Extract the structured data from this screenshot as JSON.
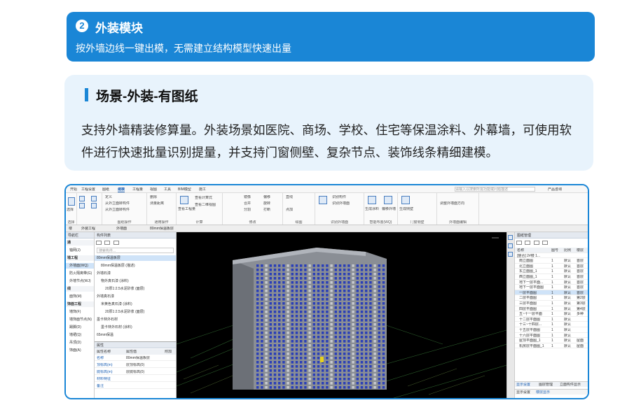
{
  "header": {
    "number": "2",
    "title": "外装模块",
    "subtitle": "按外墙边线一键出模，无需建立结构模型快速出量"
  },
  "card": {
    "title": "场景-外装-有图纸",
    "description": "支持外墙精装修算量。外装场景如医院、商场、学校、住宅等保温涂料、外幕墙，可使用软件进行快速批量识别提量，并支持门窗侧壁、复杂节点、装饰线条精细建模。"
  },
  "app": {
    "menu": [
      "开始",
      "工程设置",
      "图纸",
      "建模",
      "工程量",
      "视图",
      "工具",
      "BIM模型",
      "施工"
    ],
    "active_menu": "建模",
    "search_placeholder": "请输入以搜索所需功能或问题描述",
    "account": "产品咨询",
    "ribbon_groups": [
      {
        "label": "选择",
        "items": [
          "选择"
        ]
      },
      {
        "label": "图纸操作",
        "items": [
          "定义",
          "从外立面转构件",
          "从外立面转构件"
        ]
      },
      {
        "label": "通用操作",
        "items": [
          "删除",
          "测量距离"
        ]
      },
      {
        "label": "计算",
        "items": [
          "查看工程量",
          "查看计算式",
          "查看二维视图"
        ]
      },
      {
        "label": "修改",
        "items": [
          "镜像",
          "偏移",
          "合并",
          "分割",
          "旋转",
          "打断"
        ]
      },
      {
        "label": "绘图",
        "items": [
          "直线",
          "点加"
        ]
      },
      {
        "label": "识别外墙面",
        "items": [
          "识别构件",
          "识别外墙面"
        ]
      },
      {
        "label": "智能布置(WQ)",
        "items": [
          "生成涂料",
          "偏移外墙"
        ]
      },
      {
        "label": "门窗侧壁",
        "items": [
          "生成侧壁"
        ]
      },
      {
        "label": "外墙面编辑",
        "items": [
          "调整外墙面方向"
        ]
      }
    ],
    "sub_bar": [
      "楼",
      "外装工程",
      "外墙面",
      "80mm保温板层"
    ],
    "nav": {
      "title": "导航栏",
      "items": [
        "通",
        "轴网(J)",
        "墙工程",
        "外墙面(WQ)",
        "防火隔离带(G)",
        "外墙节点(WJ)",
        "线",
        "面饰(M)",
        "饰面工程",
        "墙饰(F)",
        "墙饰面节点(N)",
        "踢脚(D)",
        "墙裙(Q)",
        "吊顶(D)",
        "饰面(A)"
      ]
    },
    "tree": {
      "title": "构件列表",
      "search_placeholder": "搜索构件...",
      "items": [
        "80mm保温板层",
        "80mm保温板层 (描述)",
        "外墙石漆",
        "物外真石漆 (涂料)",
        "20厚1:2.5水泥砂浆 (面层)",
        "外墙真石漆",
        "米黄色真石漆 (涂料)",
        "20厚1:2.5水泥砂浆 (面层)",
        "墨卡林外石材",
        "墨卡林外石材 (涂料)",
        "65mm保温"
      ]
    },
    "props": {
      "title": "属性",
      "columns": [
        "属性名称",
        "属性值",
        "附加"
      ],
      "rows": [
        [
          "名称",
          "80mm保温板层"
        ],
        [
          "顶标高(m)",
          "层顶标高(0)"
        ],
        [
          "底标高(m)",
          "层底标高(0)"
        ],
        [
          "材料特征",
          ""
        ],
        [
          "备注",
          ""
        ]
      ]
    },
    "drawings": {
      "title": "图纸管理",
      "columns": [
        "名称",
        "图号",
        "比例",
        "楼层"
      ],
      "rows": [
        [
          "[整合] 2#楼 1...",
          "",
          "",
          ""
        ],
        [
          "南立面图",
          "1",
          "默认",
          "首层"
        ],
        [
          "北立面图",
          "1",
          "默认",
          "首层"
        ],
        [
          "东立面图_1",
          "1",
          "默认",
          "首层"
        ],
        [
          "西立面图_1",
          "1",
          "默认",
          "首层"
        ],
        [
          "地下一层平面...",
          "1",
          "默认",
          "首层"
        ],
        [
          "地下一层平面图",
          "1",
          "默认",
          "首层"
        ],
        [
          "一层平面图",
          "1",
          "默认",
          "首层"
        ],
        [
          "二层平面图",
          "1",
          "默认",
          "第2层"
        ],
        [
          "三层平面图",
          "1",
          "默认",
          "第3层"
        ],
        [
          "四层平面图",
          "1",
          "默认",
          "第4层"
        ],
        [
          "五~十一层平面",
          "1",
          "默认",
          "多种"
        ],
        [
          "十二层平面图",
          "1",
          "默认",
          ""
        ],
        [
          "十三~十四层...",
          "1",
          "默认",
          ""
        ],
        [
          "十五层平面图",
          "1",
          "默认",
          ""
        ],
        [
          "十六层平面图",
          "1",
          "默认",
          ""
        ],
        [
          "屋顶平面图_1",
          "1",
          "默认",
          "屋面"
        ],
        [
          "机房层平面图_1",
          "1",
          "默认",
          "屋面"
        ]
      ],
      "tabs": [
        "显示设置",
        "图层管理",
        "立面构件显示"
      ],
      "bottom_tabs": [
        "显示设置",
        "楼层显示"
      ]
    }
  }
}
